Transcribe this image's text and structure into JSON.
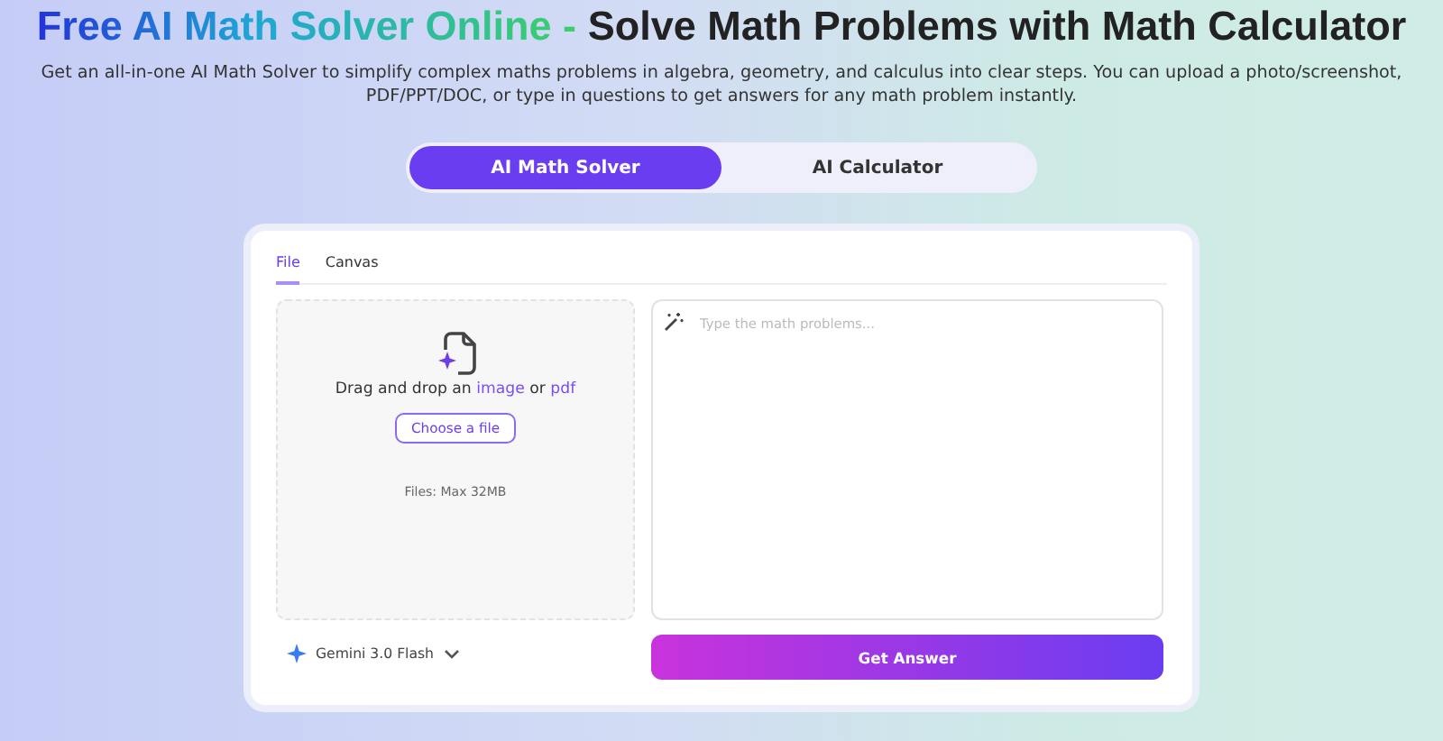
{
  "header": {
    "title_highlight": "Free AI Math Solver Online -",
    "title_rest": "Solve Math Problems with Math Calculator",
    "description": "Get an all-in-one AI Math Solver to simplify complex maths problems in algebra, geometry, and calculus into clear steps. You can upload a photo/screenshot, PDF/PPT/DOC, or type in questions to get answers for any math problem instantly."
  },
  "mode_tabs": [
    {
      "label": "AI Math Solver",
      "selected": true
    },
    {
      "label": "AI Calculator",
      "selected": false
    }
  ],
  "input_tabs": [
    {
      "label": "File",
      "selected": true
    },
    {
      "label": "Canvas",
      "selected": false
    }
  ],
  "upload": {
    "prompt": "Drag and drop an",
    "image_link": "image",
    "joiner": "or",
    "pdf_link": "pdf",
    "button": "Choose a file",
    "limit": "Files: Max 32MB"
  },
  "question": {
    "placeholder": "Type the math problems..."
  },
  "model": {
    "label": "Gemini 3.0 Flash"
  },
  "submit": "Get Answer"
}
